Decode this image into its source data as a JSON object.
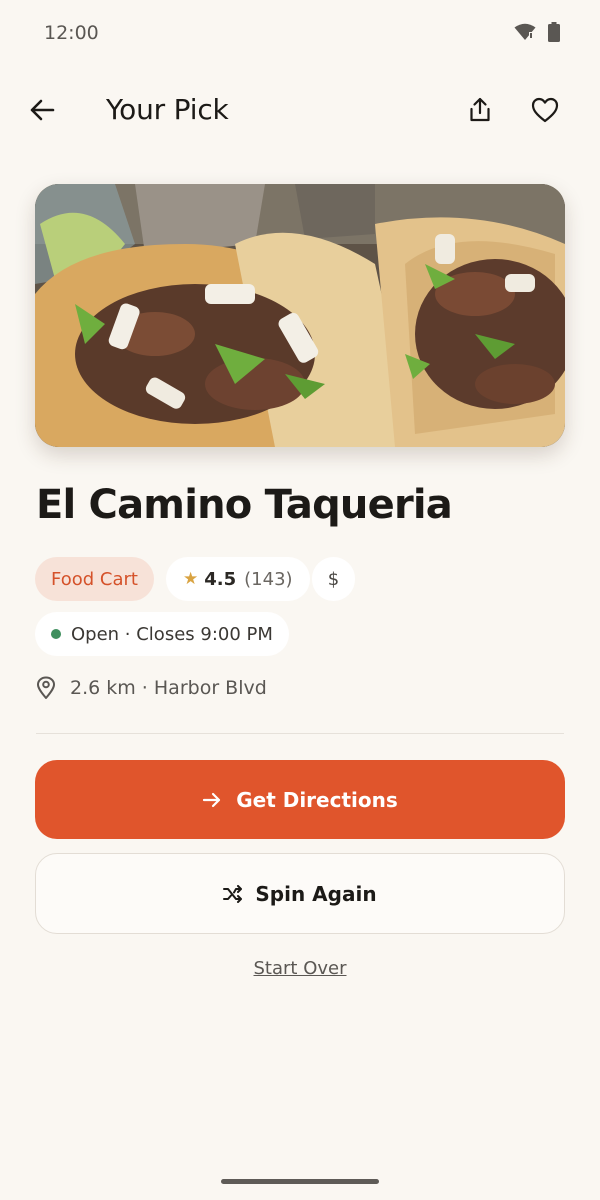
{
  "status_bar": {
    "time": "12:00"
  },
  "app_bar": {
    "title": "Your Pick"
  },
  "place": {
    "name": "El Camino Taqueria",
    "category": "Food Cart",
    "rating": "4.5",
    "review_count": "(143)",
    "price": "$",
    "hours": "Open · Closes 9:00 PM",
    "location": "2.6 km · Harbor Blvd"
  },
  "actions": {
    "directions_label": "Get Directions",
    "spin_label": "Spin Again",
    "start_over_label": "Start Over"
  },
  "colors": {
    "accent": "#e0552c",
    "category_bg": "#f7e2d8",
    "open_status": "#3f8f5e",
    "star": "#d9a341",
    "background": "#faf7f2"
  },
  "icons": [
    "wifi-icon",
    "battery-icon",
    "back-arrow-icon",
    "share-icon",
    "heart-icon",
    "star-icon",
    "location-pin-icon",
    "arrow-right-icon",
    "shuffle-icon"
  ]
}
